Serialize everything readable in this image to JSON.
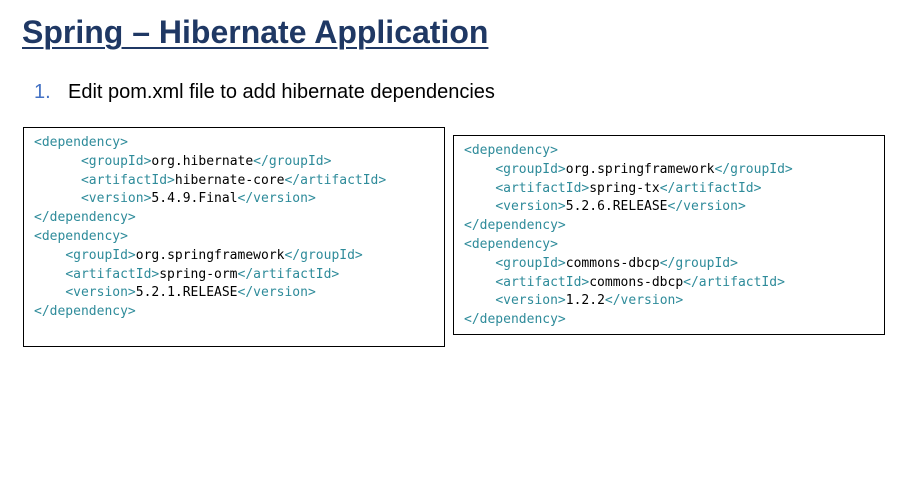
{
  "slide": {
    "title": "Spring – Hibernate Application",
    "step": {
      "number": "1.",
      "text": "Edit pom.xml file to add hibernate dependencies"
    }
  },
  "colors": {
    "title": "#1f3864",
    "step_number": "#4472c4",
    "xml_tag": "#2e8b9a",
    "xml_value": "#000000"
  },
  "code_blocks": [
    {
      "lines": [
        {
          "indent": "",
          "open": "<dependency>",
          "value": "",
          "close": ""
        },
        {
          "indent": "      ",
          "open": "<groupId>",
          "value": "org.hibernate",
          "close": "</groupId>"
        },
        {
          "indent": "      ",
          "open": "<artifactId>",
          "value": "hibernate-core",
          "close": "</artifactId>"
        },
        {
          "indent": "      ",
          "open": "<version>",
          "value": "5.4.9.Final",
          "close": "</version>"
        },
        {
          "indent": "",
          "open": "</dependency>",
          "value": "",
          "close": ""
        },
        {
          "indent": "",
          "open": "<dependency>",
          "value": "",
          "close": ""
        },
        {
          "indent": "    ",
          "open": "<groupId>",
          "value": "org.springframework",
          "close": "</groupId>"
        },
        {
          "indent": "    ",
          "open": "<artifactId>",
          "value": "spring-orm",
          "close": "</artifactId>"
        },
        {
          "indent": "    ",
          "open": "<version>",
          "value": "5.2.1.RELEASE",
          "close": "</version>"
        },
        {
          "indent": "",
          "open": "</dependency>",
          "value": "",
          "close": ""
        }
      ]
    },
    {
      "lines": [
        {
          "indent": "",
          "open": "<dependency>",
          "value": "",
          "close": ""
        },
        {
          "indent": "    ",
          "open": "<groupId>",
          "value": "org.springframework",
          "close": "</groupId>"
        },
        {
          "indent": "    ",
          "open": "<artifactId>",
          "value": "spring-tx",
          "close": "</artifactId>"
        },
        {
          "indent": "    ",
          "open": "<version>",
          "value": "5.2.6.RELEASE",
          "close": "</version>"
        },
        {
          "indent": "",
          "open": "</dependency>",
          "value": "",
          "close": ""
        },
        {
          "indent": "",
          "open": "<dependency>",
          "value": "",
          "close": ""
        },
        {
          "indent": "    ",
          "open": "<groupId>",
          "value": "commons-dbcp",
          "close": "</groupId>"
        },
        {
          "indent": "    ",
          "open": "<artifactId>",
          "value": "commons-dbcp",
          "close": "</artifactId>"
        },
        {
          "indent": "    ",
          "open": "<version>",
          "value": "1.2.2",
          "close": "</version>"
        },
        {
          "indent": "",
          "open": "</dependency>",
          "value": "",
          "close": ""
        }
      ]
    }
  ]
}
